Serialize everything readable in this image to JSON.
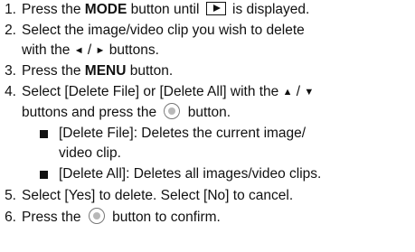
{
  "steps": [
    {
      "num": "1.",
      "pre": "Press the ",
      "bold": "MODE",
      "mid": " button until ",
      "post": " is displayed."
    },
    {
      "num": "2.",
      "line1": "Select the image/video clip you wish to delete",
      "line2_pre": "with the ",
      "left_arrow": "◄",
      "sep": " / ",
      "right_arrow": "►",
      "line2_post": " buttons."
    },
    {
      "num": "3.",
      "pre": "Press the ",
      "bold": "MENU",
      "post": " button."
    },
    {
      "num": "4.",
      "line1_pre": "Select [Delete File] or [Delete All] with the ",
      "up_arrow": "▲",
      "sep": " / ",
      "down_arrow": "▼",
      "line2_pre": "buttons and press  the ",
      "line2_post": " button."
    },
    {
      "num": "5.",
      "text": "Select [Yes] to delete. Select [No] to cancel."
    },
    {
      "num": "6.",
      "pre": "Press the ",
      "post": " button to confirm."
    }
  ],
  "sub_items": [
    {
      "line1": "[Delete File]: Deletes the current image/",
      "line2": "video clip."
    },
    {
      "line1": "[Delete All]: Deletes all images/video clips."
    }
  ]
}
